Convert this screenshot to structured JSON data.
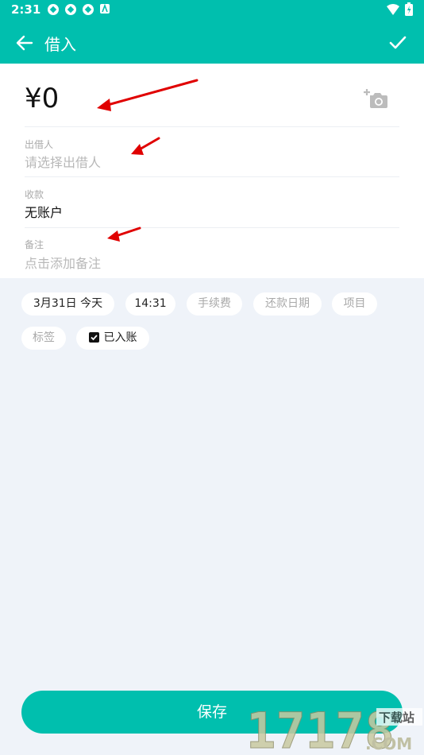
{
  "status": {
    "time": "2:31"
  },
  "header": {
    "title": "借入"
  },
  "form": {
    "amount": "¥0",
    "lender": {
      "label": "出借人",
      "placeholder": "请选择出借人"
    },
    "receipt": {
      "label": "收款",
      "value": "无账户"
    },
    "note": {
      "label": "备注",
      "placeholder": "点击添加备注"
    }
  },
  "chips": {
    "date": "3月31日  今天",
    "time": "14:31",
    "fee": "手续费",
    "repay_date": "还款日期",
    "project": "项目",
    "tag": "标签",
    "recorded": "已入账"
  },
  "actions": {
    "save": "保存"
  },
  "watermark": {
    "text": "17178",
    "sub": "下载站",
    "domain": ".COM"
  },
  "colors": {
    "accent": "#00bfae",
    "background": "#eff3f9",
    "arrow": "#e00000"
  }
}
